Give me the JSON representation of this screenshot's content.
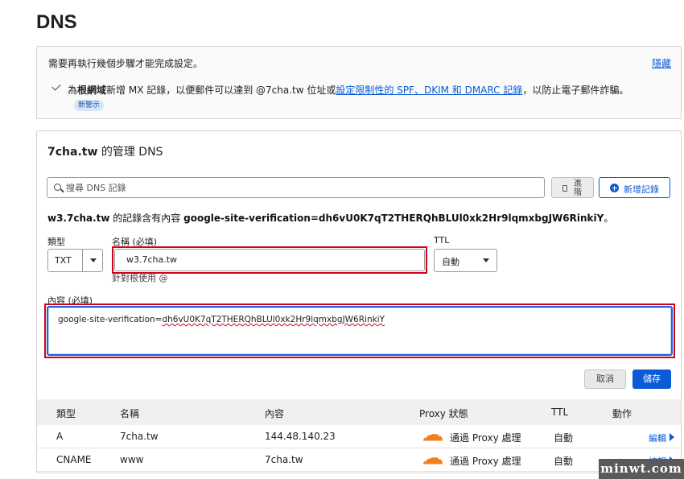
{
  "page": {
    "title": "DNS"
  },
  "alert": {
    "title": "需要再執行幾個步驟才能完成設定。",
    "hide_label": "隱藏",
    "text_prefix": "為",
    "text_bold": "根網域",
    "text_mid": "新增 MX 記錄，以便郵件可以達到 @7cha.tw 位址或",
    "text_link": "設定限制性的 SPF、DKIM 和 DMARC 記錄",
    "text_suffix": "，以防止電子郵件詐騙。",
    "badge": "新警示"
  },
  "dns": {
    "domain": "7cha.tw",
    "title_suffix": " 的管理 DNS",
    "search_placeholder": "搜尋 DNS 記錄",
    "advanced_label": "進階",
    "add_label": "新增記錄",
    "record_desc_name": "w3.7cha.tw",
    "record_desc_mid": " 的記錄含有內容 ",
    "record_desc_content": "google-site-verification=dh6vU0K7qT2THERQhBLUl0xk2Hr9lqmxbgJW6RinkiY",
    "record_desc_end": "。"
  },
  "form": {
    "type_label": "類型",
    "type_value": "TXT",
    "name_label": "名稱 (必填)",
    "name_value": "w3.7cha.tw",
    "name_hint": "針對根使用 @",
    "ttl_label": "TTL",
    "ttl_value": "自動",
    "content_label": "內容 (必填)",
    "content_prefix": "google-site-verification=",
    "content_token": "dh6vU0K7qT2THERQhBLUl0xk2Hr9lqmxbgJW6RinkiY",
    "cancel_label": "取消",
    "save_label": "儲存"
  },
  "table": {
    "headers": [
      "類型",
      "名稱",
      "內容",
      "Proxy 狀態",
      "TTL",
      "動作"
    ],
    "rows": [
      {
        "type": "A",
        "name": "7cha.tw",
        "content": "144.48.140.23",
        "proxy": "通過 Proxy 處理",
        "ttl": "自動",
        "action": "編輯"
      },
      {
        "type": "CNAME",
        "name": "www",
        "content": "7cha.tw",
        "proxy": "通過 Proxy 處理",
        "ttl": "自動",
        "action": "編輯"
      }
    ]
  },
  "colors": {
    "accent": "#0b5ad6",
    "highlight": "#d0021b",
    "cloud": "#f38020"
  },
  "watermark": {
    "text": "minwt.com"
  }
}
